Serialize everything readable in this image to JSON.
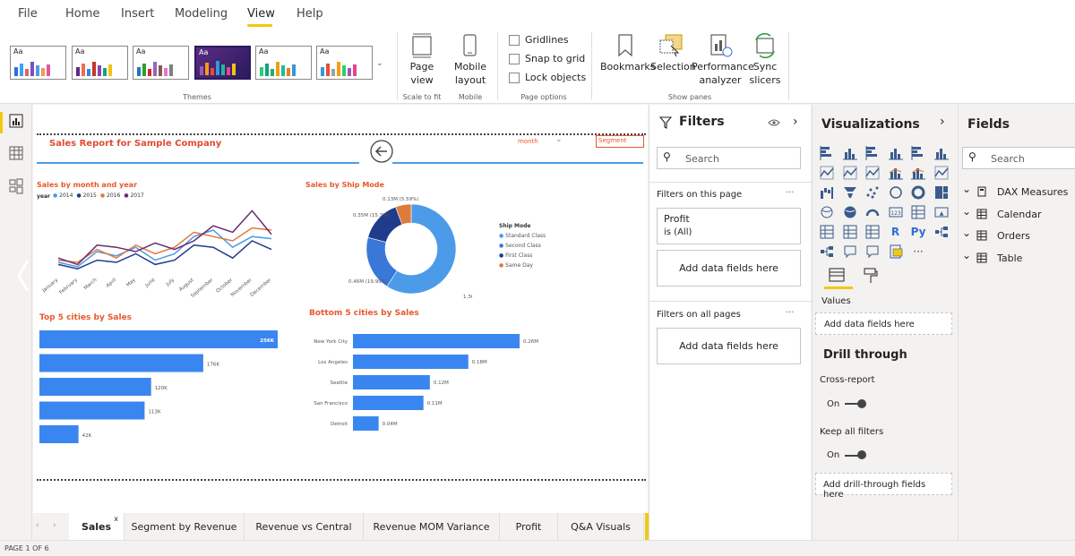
{
  "menu": {
    "file": "File",
    "home": "Home",
    "insert": "Insert",
    "modeling": "Modeling",
    "view": "View",
    "help": "Help"
  },
  "ribbon": {
    "themes_label": "Themes",
    "page_view_label": "Page view",
    "mobile_layout_label": "Mobile layout",
    "scale_to_fit_label": "Scale to fit",
    "mobile_group_label": "Mobile",
    "gridlines_label": "Gridlines",
    "snap_to_grid_label": "Snap to grid",
    "lock_objects_label": "Lock objects",
    "page_options_label": "Page options",
    "bookmarks_label": "Bookmarks",
    "selection_label": "Selection",
    "performance_label": "Performance analyzer",
    "sync_slicers_label": "Sync slicers",
    "show_panes_label": "Show panes",
    "theme_aa": "Aa"
  },
  "report": {
    "title": "Sales Report for Sample Company",
    "month_label": "month",
    "segment_label": "Segment",
    "line_chart": {
      "title": "Sales by month and year",
      "legend_title": "year",
      "months": [
        "January",
        "February",
        "March",
        "April",
        "May",
        "June",
        "July",
        "August",
        "September",
        "October",
        "November",
        "December"
      ]
    },
    "donut_chart": {
      "title": "Sales by Ship Mode",
      "legend_title": "Ship Mode",
      "label_1": "1.36M (59.12%)",
      "label_2": "0.46M (19.99%)",
      "label_3": "0.35M (15.3%)",
      "label_4": "0.13M (5.59%)"
    },
    "top5": {
      "title": "Top 5 cities by Sales"
    },
    "bottom5": {
      "title": "Bottom 5 cities by Sales"
    }
  },
  "chart_data": [
    {
      "type": "line",
      "title": "Sales by month and year",
      "x": [
        "January",
        "February",
        "March",
        "April",
        "May",
        "June",
        "July",
        "August",
        "September",
        "October",
        "November",
        "December"
      ],
      "series": [
        {
          "name": "2014",
          "color": "#4c9be8",
          "values": [
            5,
            3,
            10,
            8,
            12,
            6,
            9,
            17,
            20,
            12,
            17,
            16
          ]
        },
        {
          "name": "2015",
          "color": "#1f3b8c",
          "values": [
            4,
            2,
            6,
            5,
            9,
            4,
            6,
            13,
            12,
            7,
            15,
            11
          ]
        },
        {
          "name": "2016",
          "color": "#e07a3c",
          "values": [
            6,
            5,
            11,
            7,
            13,
            9,
            12,
            19,
            17,
            15,
            21,
            20
          ]
        },
        {
          "name": "2017",
          "color": "#6a2a6e",
          "values": [
            7,
            4,
            13,
            12,
            10,
            14,
            11,
            15,
            22,
            19,
            29,
            18
          ]
        }
      ]
    },
    {
      "type": "pie",
      "title": "Sales by Ship Mode",
      "categories": [
        "Standard Class",
        "Second Class",
        "First Class",
        "Same Day"
      ],
      "values": [
        1.36,
        0.46,
        0.35,
        0.13
      ],
      "percents": [
        59.12,
        19.99,
        15.3,
        5.59
      ],
      "colors": [
        "#4c9be8",
        "#3a78d8",
        "#1f3b8c",
        "#e07a3c"
      ]
    },
    {
      "type": "bar",
      "title": "Top 5 cities by Sales",
      "values": [
        256,
        176,
        120,
        113,
        42
      ],
      "labels": [
        "256K",
        "176K",
        "120K",
        "113K",
        "42K"
      ],
      "xlim": [
        0,
        256
      ]
    },
    {
      "type": "bar",
      "title": "Bottom 5 cities by Sales",
      "categories": [
        "New York City",
        "Los Angeles",
        "Seattle",
        "San Francisco",
        "Detroit"
      ],
      "values": [
        0.26,
        0.18,
        0.12,
        0.11,
        0.04
      ],
      "labels": [
        "0.26M",
        "0.18M",
        "0.12M",
        "0.11M",
        "0.04M"
      ],
      "xlim": [
        0,
        0.26
      ]
    }
  ],
  "tabs": [
    "Sales",
    "Segment by Revenue",
    "Revenue vs Central",
    "Revenue MOM Variance",
    "Profit",
    "Q&A Visuals"
  ],
  "tab_close": "x",
  "add_tab": "+",
  "status": "PAGE 1 OF 6",
  "filters": {
    "title": "Filters",
    "search_placeholder": "Search",
    "on_this_page": "Filters on this page",
    "profit_name": "Profit",
    "profit_value": "is (All)",
    "add_fields": "Add data fields here",
    "on_all_pages": "Filters on all pages",
    "more": "···"
  },
  "visualizations": {
    "title": "Visualizations",
    "values_label": "Values",
    "add_data_fields": "Add data fields here",
    "drill_through": "Drill through",
    "cross_report": "Cross-report",
    "cross_report_state": "On",
    "keep_all_filters": "Keep all filters",
    "keep_filters_state": "On",
    "add_drill": "Add drill-through fields here",
    "r_icon": "R",
    "py_icon": "Py",
    "more_icon": "···"
  },
  "fields": {
    "title": "Fields",
    "search_placeholder": "Search",
    "tables": [
      "DAX Measures",
      "Calendar",
      "Orders",
      "Table"
    ]
  }
}
